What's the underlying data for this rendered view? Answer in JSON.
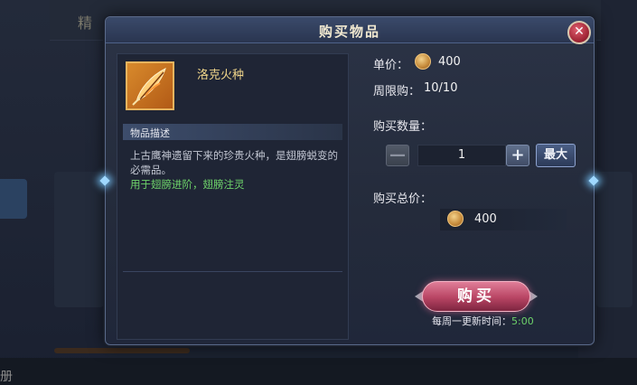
{
  "background": {
    "top_bar_glyph": "精",
    "bottom_glyph": "册"
  },
  "dialog": {
    "title": "购买物品",
    "close_glyph": "✕"
  },
  "item": {
    "name": "洛克火种",
    "icon": "feather-flame-icon",
    "description_header": "物品描述",
    "description": "上古鹰神遗留下来的珍贵火种，是翅膀蜕变的必需品。",
    "usage": "用于翅膀进阶，翅膀注灵"
  },
  "purchase": {
    "unit_price_label": "单价：",
    "unit_price": "400",
    "weekly_limit_label": "周限购：",
    "weekly_limit": "10/10",
    "quantity_label": "购买数量：",
    "quantity": "1",
    "minus_glyph": "—",
    "plus_glyph": "+",
    "max_label": "最大",
    "total_label": "购买总价：",
    "total": "400",
    "buy_label": "购买",
    "refresh_label": "每周一更新时间：",
    "refresh_time": "5:00"
  },
  "colors": {
    "accent_gold": "#f0d68a",
    "usage_green": "#6ed36a",
    "buy_pink": "#b84463",
    "close_red": "#a52838"
  }
}
